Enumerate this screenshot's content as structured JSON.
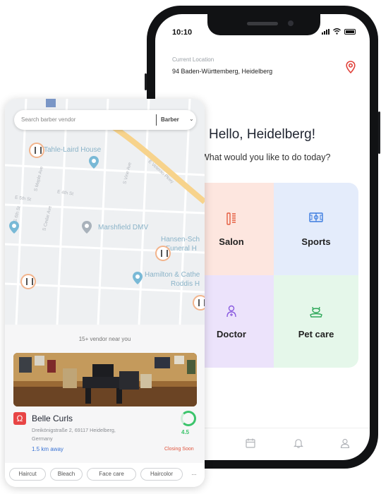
{
  "phone": {
    "status_time": "10:10",
    "location_label": "Current Location",
    "location_value": "94  Baden-Württemberg, Heidelberg",
    "greeting": "Hello, Heidelberg!",
    "prompt": "What would you like to do today?",
    "categories": [
      {
        "label": "Salon",
        "icon": "scissors-icon",
        "color": "#e45c3f"
      },
      {
        "label": "Sports",
        "icon": "court-icon",
        "color": "#3d7de0"
      },
      {
        "label": "Doctor",
        "icon": "doctor-icon",
        "color": "#8a5be0"
      },
      {
        "label": "Pet care",
        "icon": "pet-icon",
        "color": "#2fa85a"
      }
    ],
    "nav_icons": [
      "calendar-icon",
      "bell-icon",
      "profile-icon"
    ]
  },
  "map_card": {
    "search_placeholder": "Search barber vendor",
    "search_category": "Barber",
    "map_labels": [
      "Tahle-Laird House",
      "Marshfield DMV",
      "Hansen-Sch",
      "Funeral H",
      "Hamilton & Cathe",
      "Roddis H"
    ],
    "streets": [
      "E Veteran Pkwy",
      "S Maple Ave",
      "S Cedar Ave",
      "S Vine Ave",
      "E 4th St",
      "E 5th St",
      "S 6th St"
    ],
    "vendors_near": "15+ vendor near you",
    "vendor": {
      "name": "Belle Curls",
      "address": "Dreikönigstraße 2, 69117 Heidelberg, Germany",
      "rating": "4.5",
      "rating_fraction": 0.75,
      "distance": "1.5 km away",
      "status": "Closing Soon"
    },
    "services": [
      "Haircut",
      "Bleach",
      "Face care",
      "Haircolor",
      "..."
    ]
  }
}
